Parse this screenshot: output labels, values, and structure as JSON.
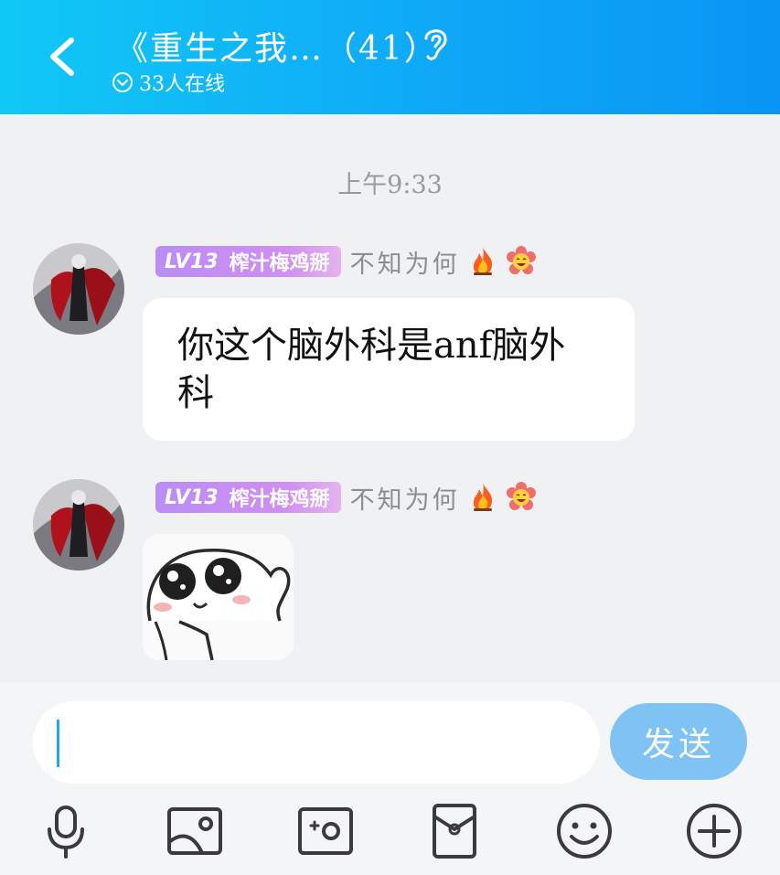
{
  "header": {
    "back_icon": "chevron-left-icon",
    "title": "《重生之我…（41）",
    "ear_icon": "ear-icon",
    "online_icon": "chevron-down-circle-icon",
    "online_text": "33人在线"
  },
  "chat": {
    "timestamp": "上午9:33",
    "messages": [
      {
        "level": "LV13",
        "name": "榨汁梅鸡掰",
        "title_tag": "不知为何",
        "text": "你这个脑外科是anf脑外科"
      },
      {
        "level": "LV13",
        "name": "榨汁梅鸡掰",
        "title_tag": "不知为何",
        "sticker": "sticker-image"
      }
    ]
  },
  "input": {
    "value": "",
    "send_label": "发送"
  },
  "toolbar": {
    "icons": [
      "microphone-icon",
      "image-icon",
      "camera-icon",
      "red-packet-icon",
      "emoji-icon",
      "plus-icon"
    ]
  },
  "colors": {
    "header_gradient_start": "#10c8f6",
    "header_gradient_end": "#0a95f4",
    "badge": "#c08df5",
    "send_button": "#7ec3f3",
    "caret": "#1aa9f2"
  }
}
